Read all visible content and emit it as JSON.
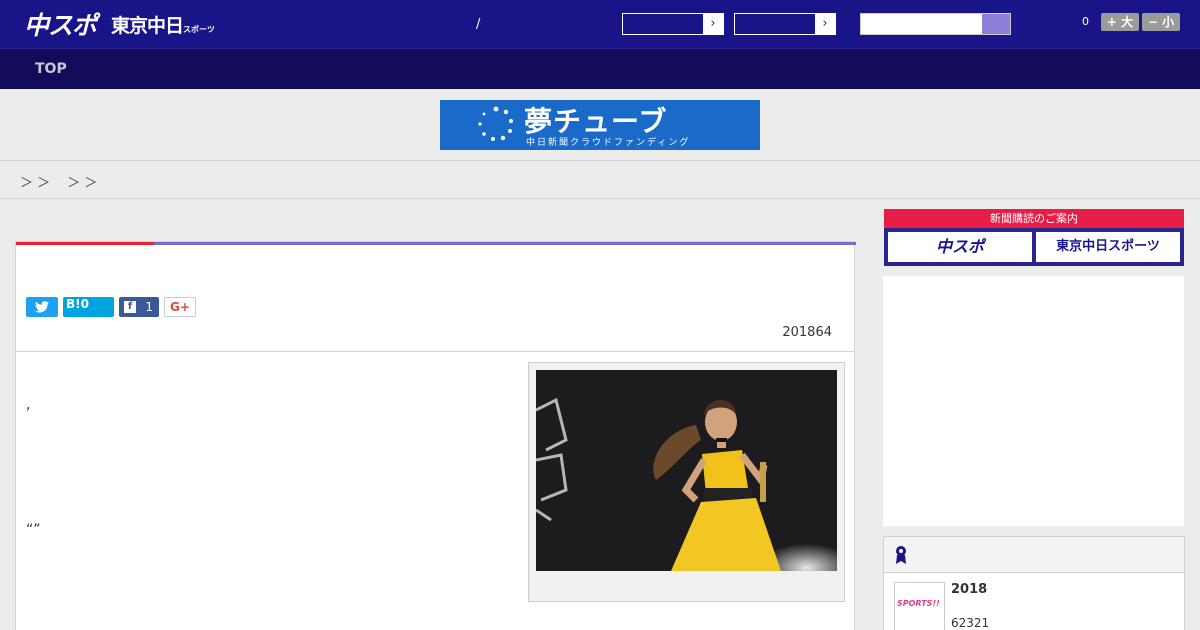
{
  "header": {
    "logo_chuspo": "中スポ",
    "logo_tokyo": "東京中日",
    "logo_tokyo_sub": "スポーツ",
    "slash": "/",
    "arrow": "›",
    "count": "0",
    "font_up": "+ 大",
    "font_down": "− 小"
  },
  "nav": {
    "top": "TOP"
  },
  "banner": {
    "title": "夢チューブ",
    "subtitle": "中日新聞クラウドファンディング"
  },
  "breadcrumb": "＞ ＞　 ＞ ＞",
  "article": {
    "twitter": "t",
    "hatena": "B!0",
    "facebook_count": "1",
    "gplus": "G+",
    "date": "201864",
    "p1": ",",
    "p2": "“”"
  },
  "sidebar": {
    "subscribe_header": "新聞購読のご案内",
    "chuspo": "中スポ",
    "tokyo": "東京中日スポーツ",
    "rank_year": "2018",
    "rank_num": "62321",
    "rank_thumb_text": "SPORTS!!"
  },
  "colors": {
    "header_bg": "#1a1489",
    "nav_bg": "#120c5b",
    "accent_red": "#e8222a",
    "accent_purple": "#7a6cc8"
  }
}
